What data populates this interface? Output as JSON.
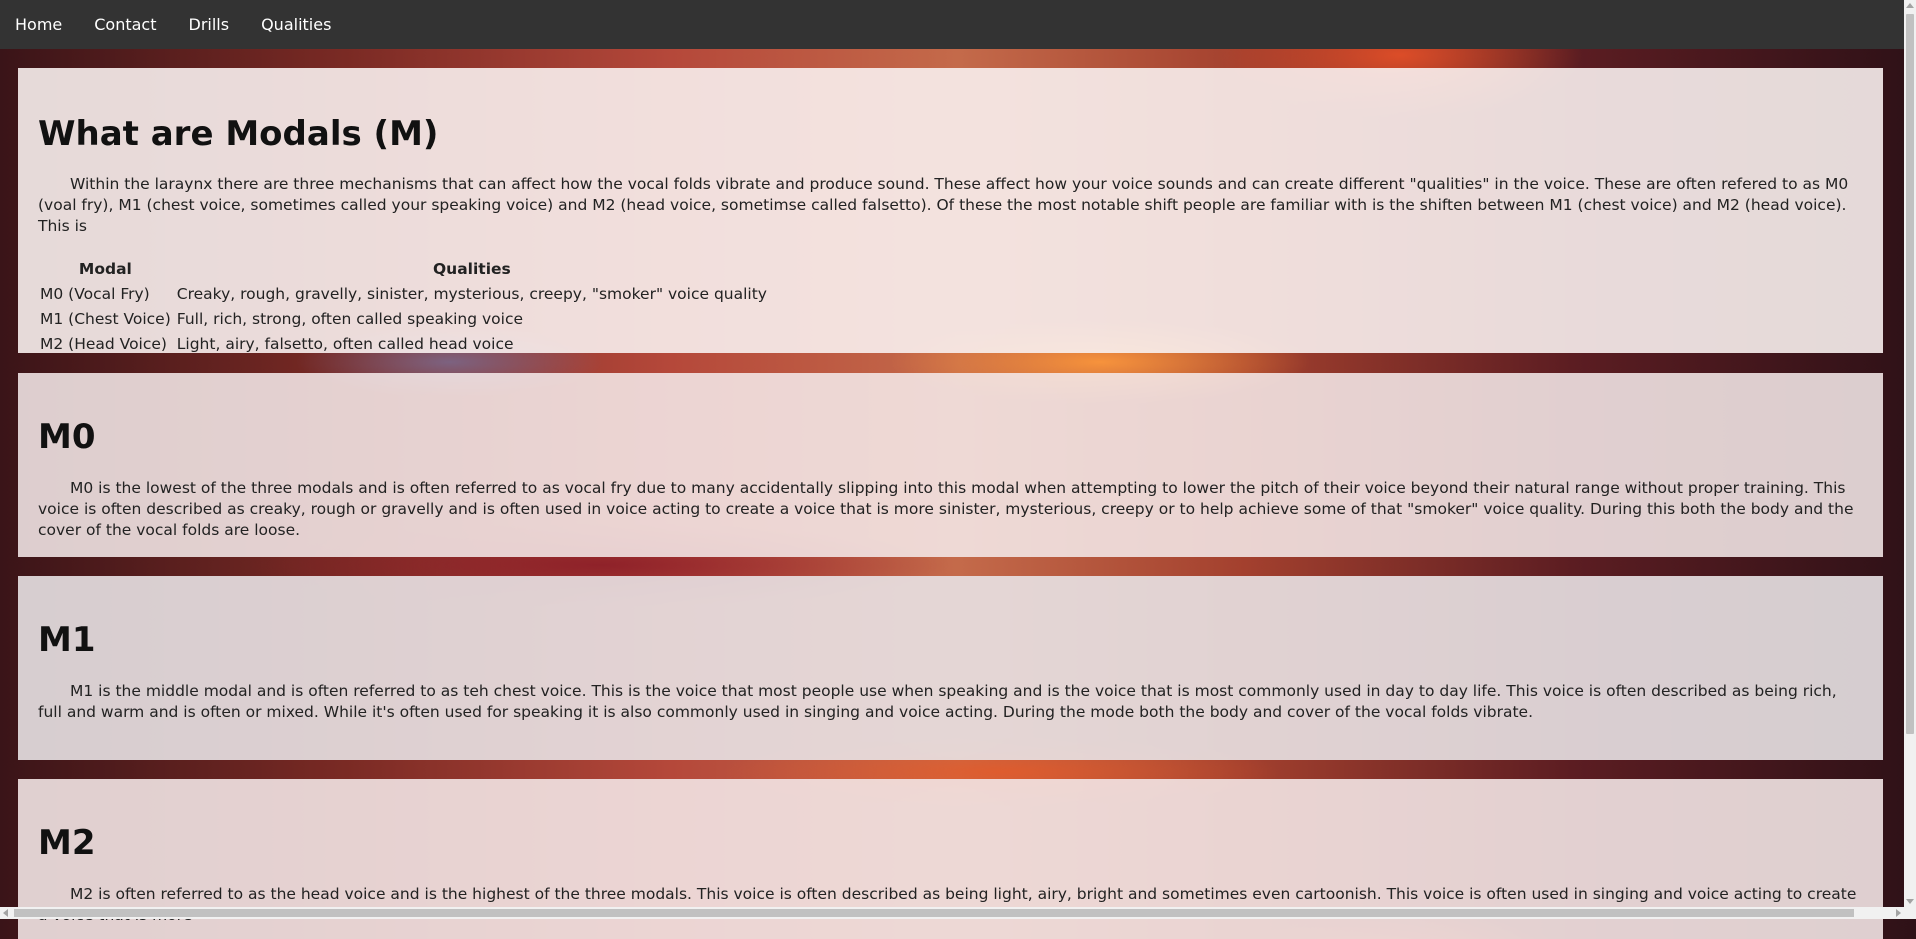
{
  "nav": {
    "items": [
      {
        "label": "Home"
      },
      {
        "label": "Contact"
      },
      {
        "label": "Drills"
      },
      {
        "label": "Qualities"
      }
    ]
  },
  "intro": {
    "title": "What are Modals (M)",
    "body": "Within the laraynx there are three mechanisms that can affect how the vocal folds vibrate and produce sound. These affect how your voice sounds and can create different \"qualities\" in the voice. These are often refered to as M0 (voal fry), M1 (chest voice, sometimes called your speaking voice) and M2 (head voice, sometimse called falsetto). Of these the most notable shift people are familiar with is the shiften between M1 (chest voice) and M2 (head voice). This is",
    "table": {
      "headers": [
        "Modal",
        "Qualities"
      ],
      "rows": [
        [
          "M0 (Vocal Fry)",
          "Creaky, rough, gravelly, sinister, mysterious, creepy, \"smoker\" voice quality"
        ],
        [
          "M1 (Chest Voice)",
          "Full, rich, strong, often called speaking voice"
        ],
        [
          "M2 (Head Voice)",
          "Light, airy, falsetto, often called head voice"
        ]
      ]
    }
  },
  "m0": {
    "title": "M0",
    "body": "M0 is the lowest of the three modals and is often referred to as vocal fry due to many accidentally slipping into this modal when attempting to lower the pitch of their voice beyond their natural range without proper training. This voice is often described as creaky, rough or gravelly and is often used in voice acting to create a voice that is more sinister, mysterious, creepy or to help achieve some of that \"smoker\" voice quality. During this both the body and the cover of the vocal folds are loose."
  },
  "m1": {
    "title": "M1",
    "body": "M1 is the middle modal and is often referred to as teh chest voice. This is the voice that most people use when speaking and is the voice that is most commonly used in day to day life. This voice is often described as being rich, full and warm and is often or mixed. While it's often used for speaking it is also commonly used in singing and voice acting. During the mode both the body and cover of the vocal folds vibrate."
  },
  "m2": {
    "title": "M2",
    "body": "M2 is often referred to as the head voice and is the highest of the three modals. This voice is often described as being light, airy, bright and sometimes even cartoonish. This voice is often used in singing and voice acting to create a voice that is more"
  }
}
